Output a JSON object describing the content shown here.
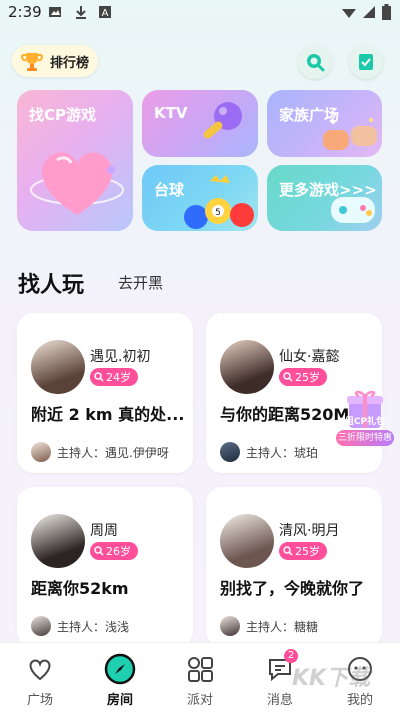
{
  "status_bar": {
    "time": "2:39"
  },
  "header": {
    "rank_label": "排行榜"
  },
  "tiles": {
    "cp": "找CP游戏",
    "ktv": "KTV",
    "family": "家族广场",
    "pool": "台球",
    "more": "更多游戏>>>"
  },
  "tabs": {
    "active": "找人玩",
    "other": "去开黑"
  },
  "cards": [
    {
      "name": "遇见.初初",
      "age": "24岁",
      "title": "附近 2 km 真的处...",
      "host": "主持人：遇见.伊伊呀"
    },
    {
      "name": "仙女·嘉懿",
      "age": "25岁",
      "title": "与你的距离520M",
      "host": "主持人：琥珀"
    },
    {
      "name": "周周",
      "age": "26岁",
      "title": "距离你52km",
      "host": "主持人：浅浅"
    },
    {
      "name": "清风·明月",
      "age": "25岁",
      "title": "别找了，今晚就你了",
      "host": "主持人：糖糖"
    }
  ],
  "gift": {
    "line1": "组CP礼包",
    "line2": "三折限时特惠"
  },
  "nav": {
    "items": [
      {
        "label": "广场"
      },
      {
        "label": "房间"
      },
      {
        "label": "派对"
      },
      {
        "label": "消息",
        "badge": "2"
      },
      {
        "label": "我的"
      }
    ]
  },
  "watermark": "KK下载",
  "colors": {
    "accent": "#ff4f9a",
    "badge": "#ff4f9a"
  }
}
